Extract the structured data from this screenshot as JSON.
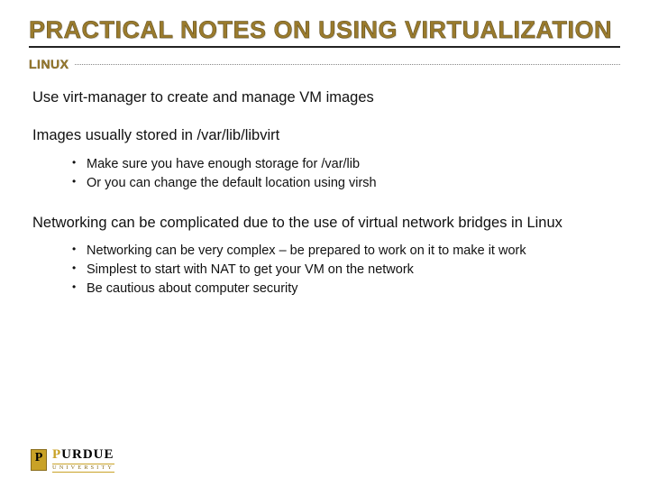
{
  "title": "PRACTICAL NOTES ON USING VIRTUALIZATION",
  "subtitle": "LINUX",
  "body": {
    "p1": "Use virt-manager to create and manage VM images",
    "p2": "Images usually stored in /var/lib/libvirt",
    "p2_sub": {
      "a": "Make sure you have enough storage for /var/lib",
      "b": "Or you can change the default location using virsh"
    },
    "p3": "Networking can be complicated due to the use of virtual network bridges in Linux",
    "p3_sub": {
      "a": "Networking can be very complex – be prepared to work on it to make it work",
      "b": "Simplest to start with NAT to get your VM on the network",
      "c": "Be cautious about computer security"
    }
  },
  "logo": {
    "name_pre": "P",
    "name_rest": "URDUE",
    "sub": "UNIVERSITY"
  }
}
